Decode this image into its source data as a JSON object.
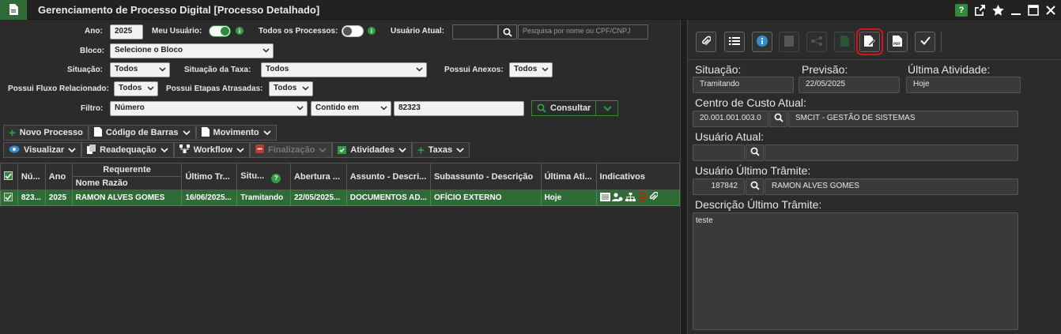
{
  "window": {
    "title": "Gerenciamento de Processo Digital  [Processo Detalhado]",
    "help": "?"
  },
  "filters": {
    "ano_label": "Ano:",
    "ano_value": "2025",
    "meu_usuario_label": "Meu Usuário:",
    "todos_processos_label": "Todos os Processos:",
    "usuario_atual_label": "Usuário Atual:",
    "usuario_atual_value": "",
    "search_placeholder": "Pesquisa por nome ou CPF/CNPJ",
    "bloco_label": "Bloco:",
    "bloco_value": "Selecione o Bloco",
    "situacao_label": "Situação:",
    "situacao_value": "Todos",
    "situacao_taxa_label": "Situação da Taxa:",
    "situacao_taxa_value": "Todos",
    "possui_anexos_label": "Possui Anexos:",
    "possui_anexos_value": "Todos",
    "fluxo_label": "Possui Fluxo Relacionado:",
    "fluxo_value": "Todos",
    "etapas_label": "Possui Etapas Atrasadas:",
    "etapas_value": "Todos",
    "filtro_label": "Filtro:",
    "filtro_field": "Número",
    "filtro_op": "Contido em",
    "filtro_value": "82323",
    "consultar": "Consultar"
  },
  "toolbar1": {
    "novo": "Novo Processo",
    "barras": "Código de Barras",
    "movimento": "Movimento"
  },
  "toolbar2": {
    "visualizar": "Visualizar",
    "readequacao": "Readequação",
    "workflow": "Workflow",
    "finalizacao": "Finalização",
    "atividades": "Atividades",
    "taxas": "Taxas"
  },
  "table": {
    "headers": {
      "numero": "Nú...",
      "ano": "Ano",
      "requerente": "Requerente",
      "nome_razao": "Nome Razão",
      "ultimo": "Último Tr...",
      "situ": "Situ...",
      "abertura": "Abertura ...",
      "assunto": "Assunto - Descri...",
      "subassunto": "Subassunto - Descrição",
      "ultima_ati": "Última Ati...",
      "indicativos": "Indicativos"
    },
    "rows": [
      {
        "numero": "823...",
        "ano": "2025",
        "nome": "RAMON ALVES GOMES",
        "ultimo": "16/06/2025...",
        "situ": "Tramitando",
        "abertura": "22/05/2025...",
        "assunto": "DOCUMENTOS AD...",
        "subassunto": "OFÍCIO EXTERNO",
        "ultima_ati": "Hoje"
      }
    ]
  },
  "detail": {
    "situacao_label": "Situação:",
    "situacao_value": "Tramitando",
    "previsao_label": "Previsão:",
    "previsao_value": "22/05/2025",
    "ultima_label": "Última Atividade:",
    "ultima_value": "Hoje",
    "centro_label": "Centro de Custo Atual:",
    "centro_code": "20.001.001.003.0",
    "centro_name": "SMCIT - GESTÃO DE SISTEMAS",
    "usuario_label": "Usuário Atual:",
    "usuario_code": "",
    "usuario_name": "",
    "usuario_ultimo_label": "Usuário Último Trâmite:",
    "usuario_ultimo_code": "187842",
    "usuario_ultimo_name": "RAMON ALVES GOMES",
    "descricao_label": "Descrição Último Trâmite:",
    "descricao_value": "teste"
  },
  "colors": {
    "accent": "#2e8b3a",
    "row": "#2e6b35",
    "highlight": "#e01010"
  }
}
